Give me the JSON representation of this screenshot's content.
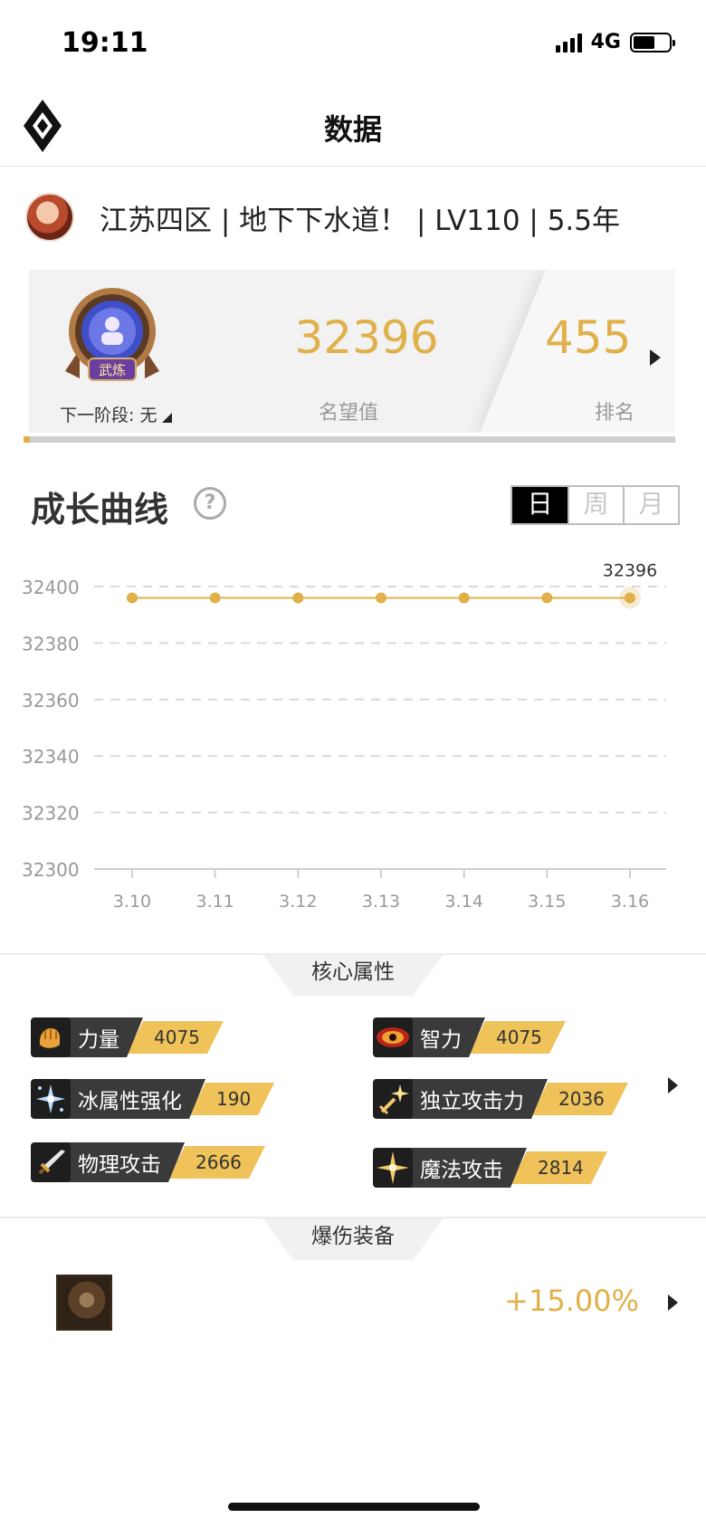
{
  "status_bar": {
    "time": "19:11",
    "network": "4G",
    "battery_level": 0.6
  },
  "nav": {
    "title": "数据",
    "logo_icon": "diamond-logo-icon"
  },
  "profile": {
    "info": "江苏四区 | 地下下水道！ | LV110 | 5.5年",
    "avatar_icon": "character-avatar"
  },
  "rank_card": {
    "badge_text": "武炼",
    "next_stage": "下一阶段: 无",
    "fame_value": "32396",
    "fame_label": "名望值",
    "rank_value": "455",
    "rank_label": "排名",
    "progress": 0.01
  },
  "growth": {
    "title": "成长曲线",
    "help_icon": "?",
    "tabs": [
      {
        "label": "日",
        "active": true
      },
      {
        "label": "周",
        "active": false
      },
      {
        "label": "月",
        "active": false
      }
    ]
  },
  "chart_data": {
    "type": "line",
    "categories": [
      "3.10",
      "3.11",
      "3.12",
      "3.13",
      "3.14",
      "3.15",
      "3.16"
    ],
    "series": [
      {
        "values": [
          32396,
          32396,
          32396,
          32396,
          32396,
          32396,
          32396
        ]
      }
    ],
    "ylim": [
      32300,
      32400
    ],
    "yticks": [
      "32400",
      "32380",
      "32360",
      "32340",
      "32320",
      "32300"
    ],
    "last_value_label": "32396",
    "grid": true,
    "color": "#e0b04a"
  },
  "core_attributes": {
    "title": "核心属性",
    "items": [
      {
        "name": "力量",
        "value": "4075",
        "icon": "fist-icon"
      },
      {
        "name": "智力",
        "value": "4075",
        "icon": "eye-icon"
      },
      {
        "name": "冰属性强化",
        "value": "190",
        "icon": "ice-crystal-icon"
      },
      {
        "name": "独立攻击力",
        "value": "2036",
        "icon": "sparkle-sword-icon"
      },
      {
        "name": "物理攻击",
        "value": "2666",
        "icon": "sword-icon"
      },
      {
        "name": "魔法攻击",
        "value": "2814",
        "icon": "star-burst-icon"
      }
    ]
  },
  "burst_equipment": {
    "title": "爆伤装备",
    "bonus": "+15.00%",
    "icon": "equipment-icon"
  }
}
